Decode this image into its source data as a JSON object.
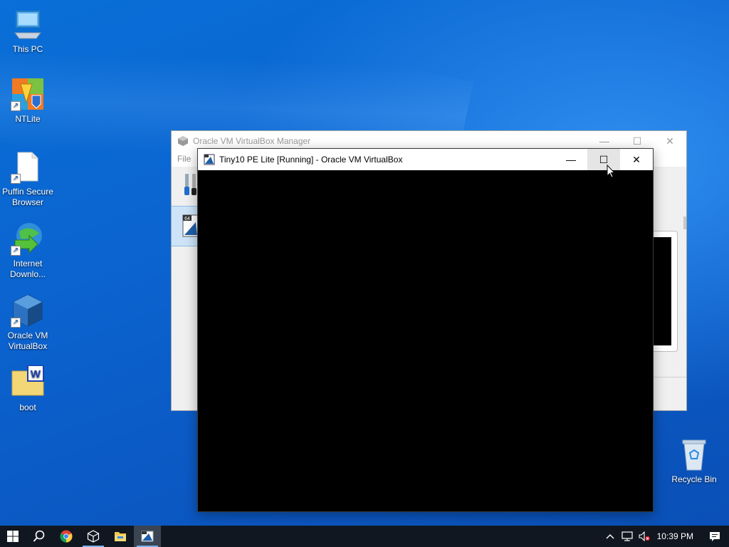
{
  "desktop": {
    "icons": [
      {
        "label": "This PC",
        "icon": "this-pc-icon"
      },
      {
        "label": "NTLite",
        "icon": "ntlite-icon"
      },
      {
        "label": "Puffin Secure Browser",
        "icon": "puffin-icon"
      },
      {
        "label": "Internet Downlo...",
        "icon": "internet-download-manager-icon"
      },
      {
        "label": "Oracle VM VirtualBox",
        "icon": "virtualbox-icon"
      },
      {
        "label": "boot",
        "icon": "boot-document-icon"
      },
      {
        "label": "Recycle Bin",
        "icon": "recycle-bin-icon"
      }
    ]
  },
  "manager_window": {
    "title": "Oracle VM VirtualBox Manager",
    "menu": [
      "File"
    ],
    "controls": {
      "minimize": "—",
      "maximize": "☐",
      "close": "✕"
    }
  },
  "vm_window": {
    "title": "Tiny10 PE Lite [Running] - Oracle VM VirtualBox",
    "controls": {
      "minimize": "—",
      "maximize": "☐",
      "close": "✕"
    },
    "hovered_control": "maximize"
  },
  "taskbar": {
    "pinned": [
      "windows-start-icon",
      "search-icon",
      "chrome-icon",
      "virtualbox-icon",
      "file-explorer-icon",
      "virtualbox-vm-icon"
    ],
    "tray": {
      "time": "10:39 PM",
      "icons": [
        "chevron-up-icon",
        "network-icon",
        "volume-muted-icon",
        "notification-icon"
      ]
    }
  },
  "colors": {
    "desktop_blue": "#0b63cf",
    "taskbar": "#101720",
    "selection": "#cde3f8"
  }
}
